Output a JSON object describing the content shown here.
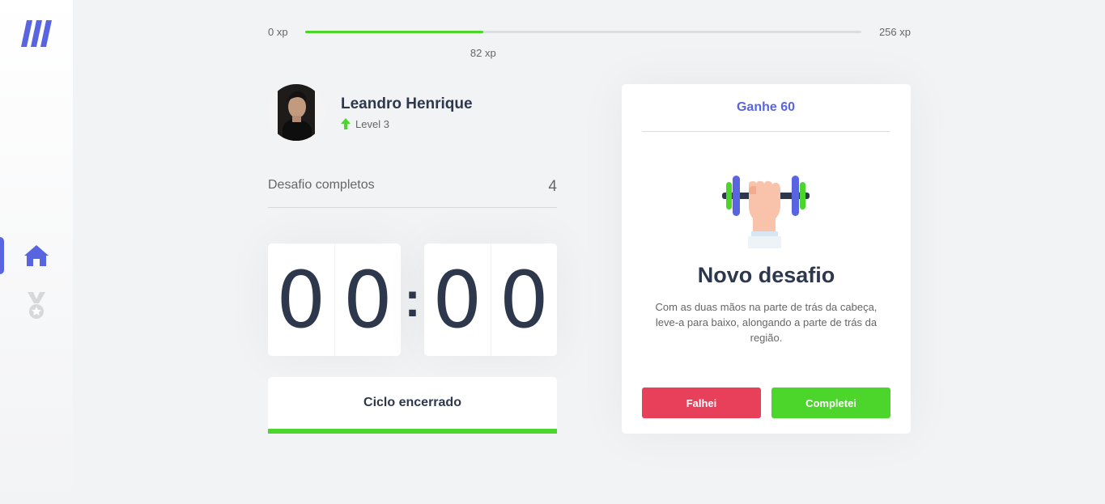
{
  "sidebar": {
    "logo_icon": "moveit-logo",
    "items": [
      {
        "icon": "home-icon",
        "active": true
      },
      {
        "icon": "award-icon",
        "active": false
      }
    ],
    "accent": "#5965e0"
  },
  "xp": {
    "start": "0 xp",
    "current": "82 xp",
    "end": "256 xp",
    "progress": 0.32,
    "bar_color": "#4cd62b"
  },
  "profile": {
    "name": "Leandro Henrique",
    "level": "Level 3"
  },
  "completed": {
    "label": "Desafio completos",
    "count": "4"
  },
  "countdown": {
    "minute_left": "0",
    "minute_right": "0",
    "separator": ":",
    "second_left": "0",
    "second_right": "0"
  },
  "cycle_button": {
    "label": "Ciclo encerrado"
  },
  "challenge": {
    "header": "Ganhe 60",
    "icon": "dumbbell-icon",
    "title": "Novo desafio",
    "description": "Com as duas mãos na parte de trás da cabeça, leve-a para baixo, alongando a parte de trás da região.",
    "fail_label": "Falhei",
    "done_label": "Completei",
    "fail_color": "#e83f5b",
    "done_color": "#4cd62b"
  }
}
